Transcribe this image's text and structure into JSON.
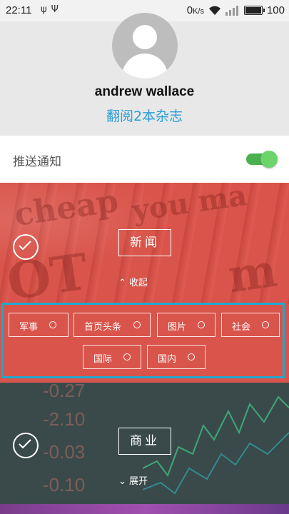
{
  "status_bar": {
    "time": "22:11",
    "left_icons": [
      "usb-icon",
      "usb-debug-icon"
    ],
    "network_speed": "0",
    "network_unit": "K/s",
    "battery": "100",
    "battery_level": 1.0
  },
  "profile": {
    "username": "andrew wallace",
    "subtitle": "翻阅2本杂志"
  },
  "settings": {
    "push_label": "推送通知",
    "push_enabled": true
  },
  "sections": [
    {
      "title": "新闻",
      "checked": true,
      "toggle_label": "收起",
      "expanded": true,
      "tags": [
        {
          "label": "军事"
        },
        {
          "label": "首页头条"
        },
        {
          "label": "图片"
        },
        {
          "label": "社会"
        },
        {
          "label": "国际"
        },
        {
          "label": "国内"
        }
      ]
    },
    {
      "title": "商业",
      "checked": true,
      "toggle_label": "展开",
      "expanded": false
    }
  ],
  "colors": {
    "accent": "#2a9fd6",
    "news_bg": "#d9544a",
    "highlight_border": "#1ea8d0",
    "toggle_on": "#4caf50"
  }
}
